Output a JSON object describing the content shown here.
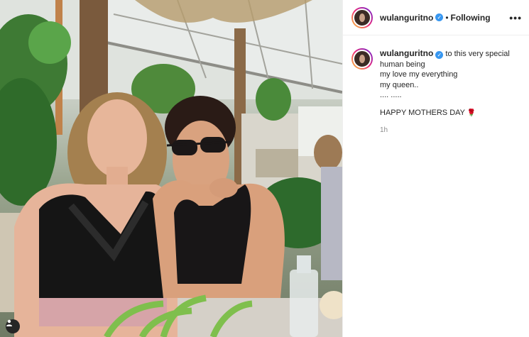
{
  "post": {
    "username": "wulanguritno",
    "follow_status": "Following",
    "more_icon": "more-horizontal-icon",
    "caption": {
      "line1": "to this very special",
      "line2": "human being",
      "line3": "my love my everything",
      "line4": "my queen..",
      "line5": ".... .....",
      "line6": "HAPPY MOTHERS DAY",
      "emoji": "🌹"
    },
    "timestamp": "1h"
  },
  "colors": {
    "verified": "#3897f0",
    "story_ring": [
      "#f9ce34",
      "#ee2a7b",
      "#6228d7"
    ]
  }
}
